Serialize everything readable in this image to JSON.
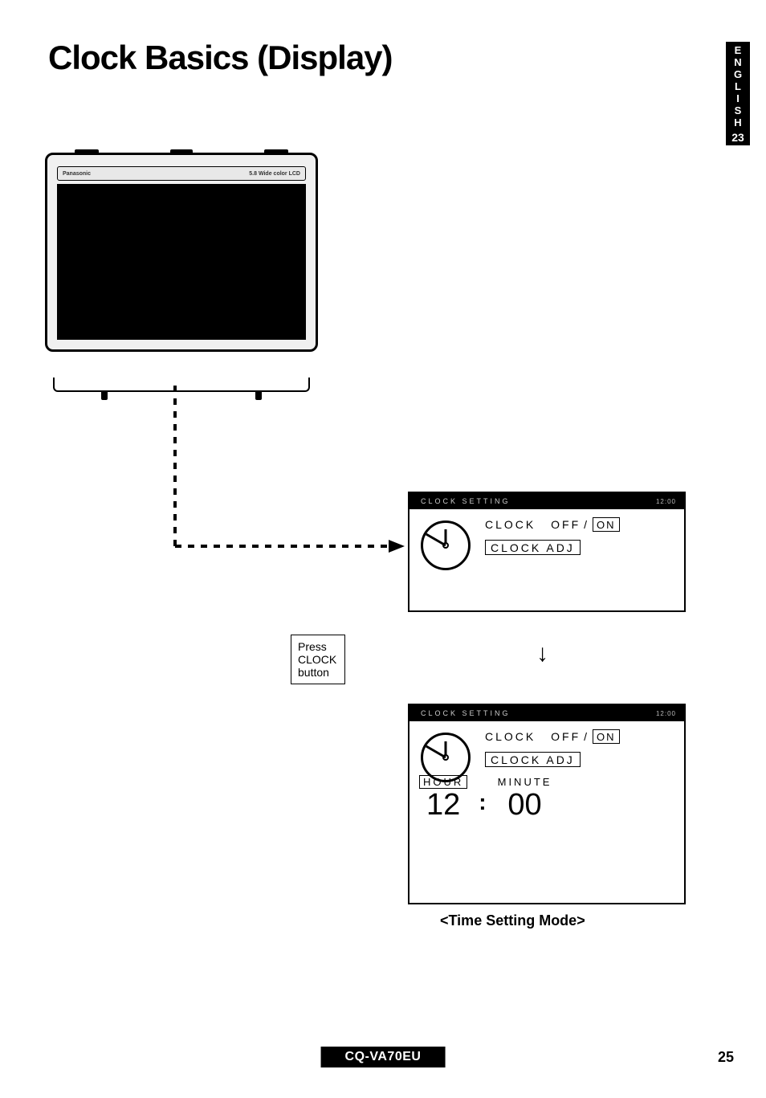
{
  "title": "Clock Basics (Display)",
  "lang_tab": {
    "letters": [
      "E",
      "N",
      "G",
      "L",
      "I",
      "S",
      "H"
    ],
    "number": "23"
  },
  "device": {
    "brand": "Panasonic",
    "label_right": "5.8 Wide color LCD"
  },
  "instruction": {
    "line1": "Press",
    "line2": "CLOCK",
    "line3": "button"
  },
  "panel1": {
    "header": "CLOCK SETTING",
    "header_right": "12:00",
    "clock_label": "CLOCK",
    "off": "OFF",
    "on": "ON",
    "adj": "CLOCK  ADJ"
  },
  "panel2": {
    "header": "CLOCK SETTING",
    "header_right": "12:00",
    "clock_label": "CLOCK",
    "off": "OFF",
    "on": "ON",
    "adj": "CLOCK  ADJ",
    "hour_label": "HOUR",
    "minute_label": "MINUTE",
    "hour_value": "12",
    "colon": ":",
    "minute_value": "00"
  },
  "caption": "<Time Setting Mode>",
  "footer": {
    "model": "CQ-VA70EU",
    "page": "25"
  }
}
